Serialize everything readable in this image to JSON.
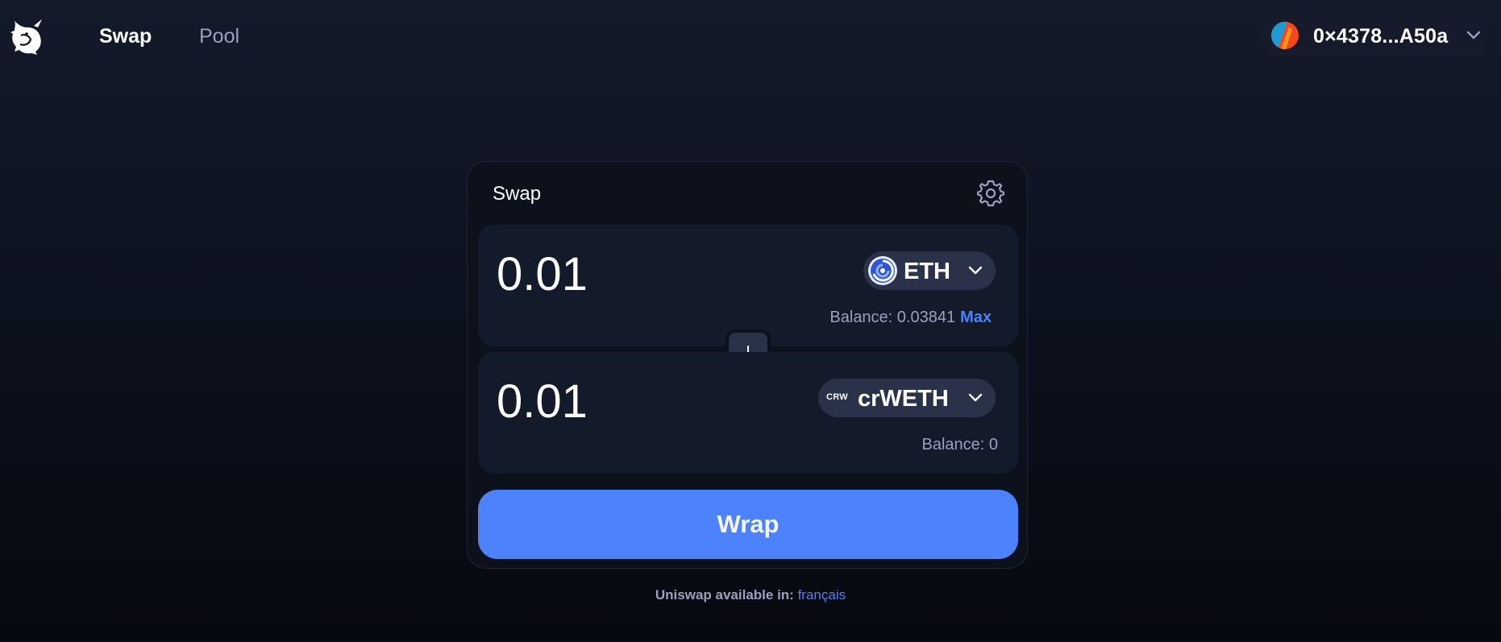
{
  "header": {
    "logo_icon": "uniswap-unicorn-icon",
    "nav": [
      {
        "label": "Swap",
        "active": true
      },
      {
        "label": "Pool",
        "active": false
      }
    ],
    "account": {
      "address": "0×4378...A50a",
      "avatar_icon": "wallet-avatar-icon",
      "chevron_icon": "chevron-down-icon"
    }
  },
  "swap": {
    "title": "Swap",
    "settings_icon": "gear-icon",
    "input": {
      "amount": "0.01",
      "token": {
        "symbol": "ETH",
        "icon": "eth-token-icon"
      },
      "balance_label": "Balance: 0.03841",
      "max_label": "Max"
    },
    "switch_icon": "arrow-down-icon",
    "output": {
      "amount": "0.01",
      "token": {
        "symbol": "crWETH",
        "icon_text": "CRW"
      },
      "balance_label": "Balance: 0"
    },
    "action_label": "Wrap"
  },
  "footer": {
    "label": "Uniswap available in:",
    "language_link": "français"
  },
  "colors": {
    "accent": "#4c82fb",
    "card_bg": "#0d111c",
    "panel_bg": "#131a2a",
    "token_button_bg": "#293249",
    "muted_text": "#98a1c0"
  }
}
